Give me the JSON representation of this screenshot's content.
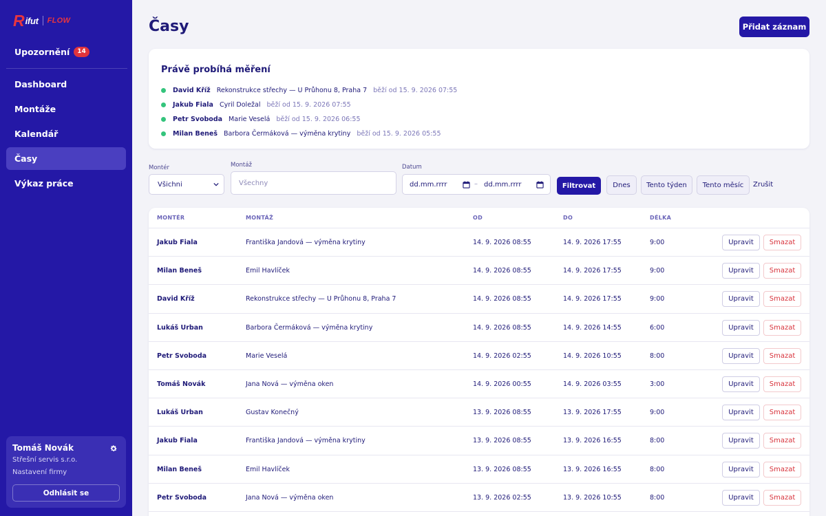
{
  "brand": {
    "logo_mark": "R",
    "logo_word": "ifut",
    "logo_product": "FLOW"
  },
  "sidebar": {
    "notifications": {
      "label": "Upozornění",
      "count": "14"
    },
    "nav": [
      {
        "label": "Dashboard",
        "active": false
      },
      {
        "label": "Montáže",
        "active": false
      },
      {
        "label": "Kalendář",
        "active": false
      },
      {
        "label": "Časy",
        "active": true
      },
      {
        "label": "Výkaz práce",
        "active": false
      }
    ],
    "user": {
      "name": "Tomáš Novák",
      "company": "Střešní servis s.r.o.",
      "settings_link": "Nastavení firmy",
      "logout_label": "Odhlásit se"
    }
  },
  "header": {
    "title": "Časy",
    "add_button": "Přidat záznam"
  },
  "running": {
    "title": "Právě probíhá měření",
    "items": [
      {
        "name": "David Kříž",
        "job": "Rekonstrukce střechy — U Průhonu 8, Praha 7",
        "since": "běží od 15. 9. 2026 07:55"
      },
      {
        "name": "Jakub Fiala",
        "job": "Cyril Doležal",
        "since": "běží od 15. 9. 2026 07:55"
      },
      {
        "name": "Petr Svoboda",
        "job": "Marie Veselá",
        "since": "běží od 15. 9. 2026 06:55"
      },
      {
        "name": "Milan Beneš",
        "job": "Barbora Čermáková — výměna krytiny",
        "since": "běží od 15. 9. 2026 05:55"
      }
    ]
  },
  "filters": {
    "worker_label": "Montér",
    "worker_value": "Všichni",
    "job_label": "Montáž",
    "job_placeholder": "Všechny",
    "date_label": "Datum",
    "date_from_placeholder": "dd.mm.rrrr",
    "date_separator": "–",
    "date_to_placeholder": "dd.mm.rrrr",
    "filter_button": "Filtrovat",
    "today_button": "Dnes",
    "week_button": "Tento týden",
    "month_button": "Tento měsíc",
    "clear_link": "Zrušit"
  },
  "table": {
    "headers": {
      "worker": "MONTÉR",
      "job": "MONTÁŽ",
      "from": "OD",
      "to": "DO",
      "duration": "DÉLKA"
    },
    "edit_label": "Upravit",
    "delete_label": "Smazat",
    "rows": [
      {
        "worker": "Jakub Fiala",
        "job": "Františka Jandová — výměna krytiny",
        "from": "14. 9. 2026 08:55",
        "to": "14. 9. 2026 17:55",
        "duration": "9:00"
      },
      {
        "worker": "Milan Beneš",
        "job": "Emil Havlíček",
        "from": "14. 9. 2026 08:55",
        "to": "14. 9. 2026 17:55",
        "duration": "9:00"
      },
      {
        "worker": "David Kříž",
        "job": "Rekonstrukce střechy — U Průhonu 8, Praha 7",
        "from": "14. 9. 2026 08:55",
        "to": "14. 9. 2026 17:55",
        "duration": "9:00"
      },
      {
        "worker": "Lukáš Urban",
        "job": "Barbora Čermáková — výměna krytiny",
        "from": "14. 9. 2026 08:55",
        "to": "14. 9. 2026 14:55",
        "duration": "6:00"
      },
      {
        "worker": "Petr Svoboda",
        "job": "Marie Veselá",
        "from": "14. 9. 2026 02:55",
        "to": "14. 9. 2026 10:55",
        "duration": "8:00"
      },
      {
        "worker": "Tomáš Novák",
        "job": "Jana Nová — výměna oken",
        "from": "14. 9. 2026 00:55",
        "to": "14. 9. 2026 03:55",
        "duration": "3:00"
      },
      {
        "worker": "Lukáš Urban",
        "job": "Gustav Konečný",
        "from": "13. 9. 2026 08:55",
        "to": "13. 9. 2026 17:55",
        "duration": "9:00"
      },
      {
        "worker": "Jakub Fiala",
        "job": "Františka Jandová — výměna krytiny",
        "from": "13. 9. 2026 08:55",
        "to": "13. 9. 2026 16:55",
        "duration": "8:00"
      },
      {
        "worker": "Milan Beneš",
        "job": "Emil Havlíček",
        "from": "13. 9. 2026 08:55",
        "to": "13. 9. 2026 16:55",
        "duration": "8:00"
      },
      {
        "worker": "Petr Svoboda",
        "job": "Jana Nová — výměna oken",
        "from": "13. 9. 2026 02:55",
        "to": "13. 9. 2026 10:55",
        "duration": "8:00"
      }
    ]
  },
  "colors": {
    "sidebar": "#2418a6",
    "accent": "#2418a6",
    "danger": "#d8323b",
    "running_dot": "#34c47c"
  }
}
